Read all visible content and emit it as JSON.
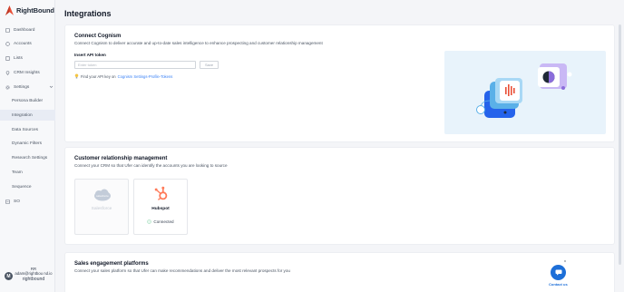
{
  "brand": {
    "name": "RightBound",
    "accent": "#e94f37"
  },
  "sidebar": {
    "items": [
      {
        "label": "Dashboard",
        "icon": "dashboard-icon"
      },
      {
        "label": "Accounts",
        "icon": "accounts-icon"
      },
      {
        "label": "Lists",
        "icon": "lists-icon"
      },
      {
        "label": "CRM Insights",
        "icon": "crm-insights-icon"
      },
      {
        "label": "Settings",
        "icon": "gear-icon"
      }
    ],
    "settings_sub": [
      "Persona Builder",
      "Integration",
      "Data Sources",
      "Dynamic Filters",
      "Research Settings",
      "Team",
      "Sequence"
    ],
    "active_sub": "Integration",
    "so_item": {
      "label": "SO",
      "icon": "so-icon"
    }
  },
  "user": {
    "avatar_letter": "M",
    "initials": "RR",
    "email": "adam@rightbou nd.io",
    "company": "rightbound"
  },
  "page": {
    "title": "Integrations"
  },
  "cognism": {
    "title": "Connect Cognism",
    "subtitle": "Connect Cognism to deliver accurate and up-to-date sales intelligence to enhance prospecting and customer relationship management",
    "api_label": "Insert API token",
    "api_placeholder": "Enter token",
    "save_label": "Save",
    "hint_prefix": "Find your API key on",
    "hint_link": "Cognism Settings-Profile-Tokens"
  },
  "crm": {
    "title": "Customer relationship management",
    "subtitle": "Connect your CRM so that Ufer can identify the accounts you are looking to source",
    "tiles": [
      {
        "name": "Salesforce",
        "status": "",
        "color": "#a6b4c8"
      },
      {
        "name": "Hubspot",
        "status": "Connected",
        "color": "#ff7a59"
      }
    ]
  },
  "engagement": {
    "title": "Sales engagement platforms",
    "subtitle": "Connect your sales platform so that Ufer can make recommendations and deliver the most relevant prospects for you"
  },
  "contact": {
    "label": "Contact us",
    "close": "x"
  }
}
